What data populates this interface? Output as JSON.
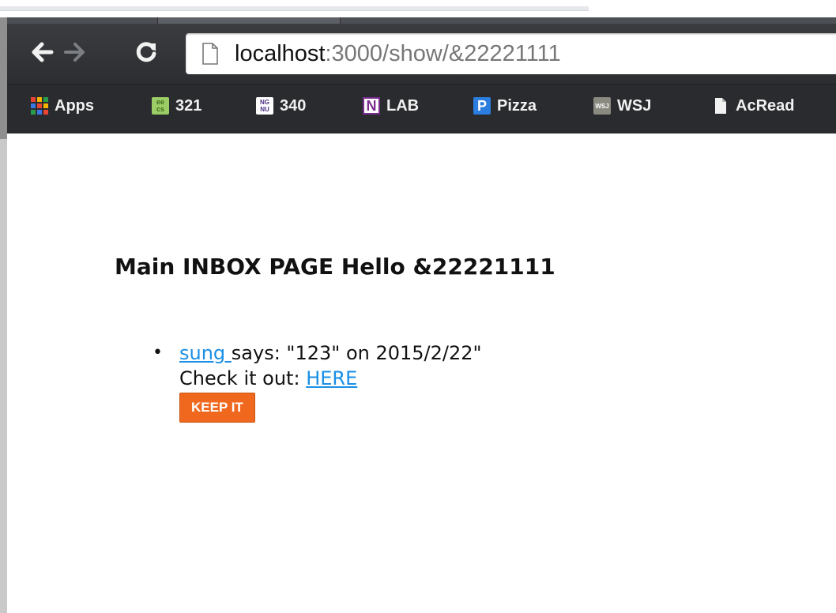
{
  "browser": {
    "url_host": "localhost",
    "url_path": ":3000/show/&22221111",
    "bookmarks": [
      {
        "label": "Apps",
        "icon": "apps-grid-icon"
      },
      {
        "label": "321",
        "icon": "eecs-icon",
        "icon_text": "ee cs"
      },
      {
        "label": "340",
        "icon": "ngnu-icon",
        "icon_text": "NG NU"
      },
      {
        "label": "LAB",
        "icon": "onenote-icon",
        "icon_text": "N"
      },
      {
        "label": "Pizza",
        "icon": "pandora-icon",
        "icon_text": "P"
      },
      {
        "label": "WSJ",
        "icon": "wsj-icon",
        "icon_text": "WSJ"
      },
      {
        "label": "AcRead",
        "icon": "page-icon"
      }
    ]
  },
  "page": {
    "heading": "Main INBOX PAGE Hello &22221111",
    "messages": [
      {
        "sender": "sung ",
        "says_text": "says: \"123\" on 2015/2/22\"",
        "check_prefix": "Check it out: ",
        "link_label": "HERE",
        "button_label": "KEEP IT"
      }
    ]
  },
  "colors": {
    "link": "#1a8fe6",
    "button": "#f0681e",
    "toolbar": "#2b2c2f"
  }
}
